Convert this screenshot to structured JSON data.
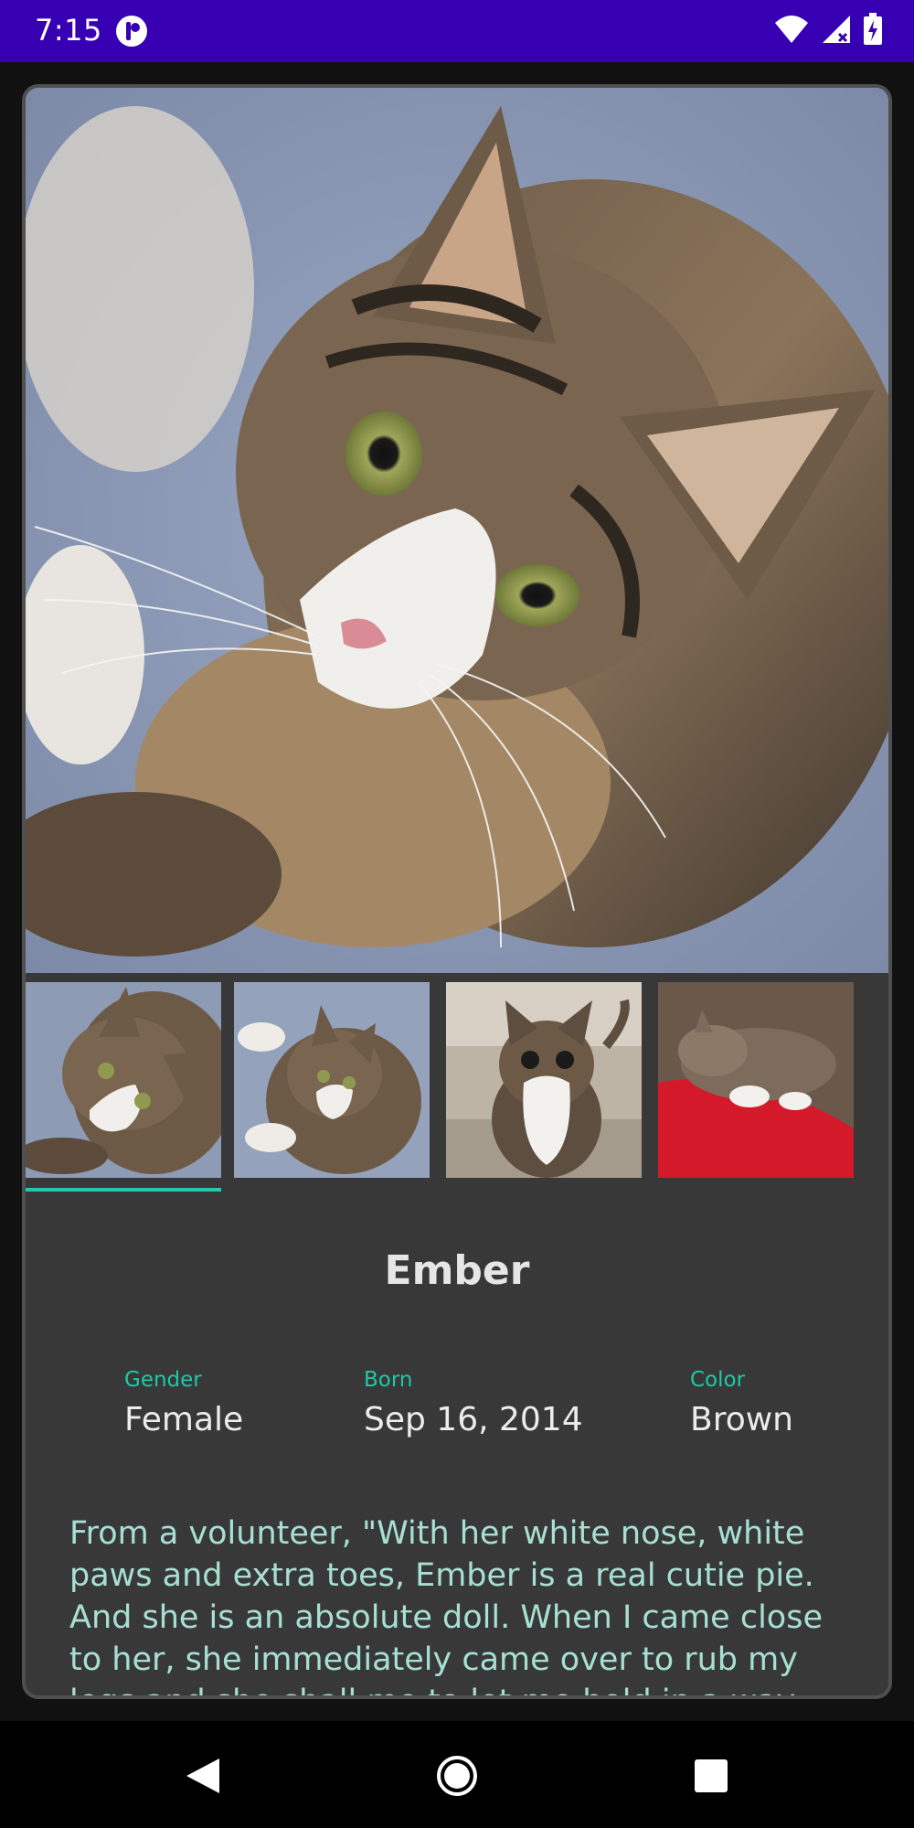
{
  "status_bar": {
    "time": "7:15",
    "icons": [
      "app-notification-icon",
      "wifi-icon",
      "signal-icon",
      "battery-charging-icon"
    ]
  },
  "pet": {
    "name": "Ember",
    "facts": [
      {
        "label": "Gender",
        "value": "Female"
      },
      {
        "label": "Born",
        "value": "Sep 16, 2014"
      },
      {
        "label": "Color",
        "value": "Brown"
      }
    ],
    "description": "From a volunteer, \"With her white nose, white paws and extra toes, Ember is a real cutie pie. And she is an absolute doll. When I came close to her, she immediately came over to rub my legs and she shall me to let me hold in a way. And"
  },
  "gallery": {
    "selected_index": 0,
    "thumbnails": [
      "cat-photo-1",
      "cat-photo-2",
      "cat-photo-3",
      "cat-photo-4"
    ]
  },
  "nav_bar": {
    "buttons": [
      "back-icon",
      "home-icon",
      "recents-icon"
    ]
  },
  "colors": {
    "status_bar": "#3700b3",
    "accent": "#26c6b0",
    "label": "#1fc8a8",
    "description": "#a7e0d2",
    "card": "#383838"
  }
}
